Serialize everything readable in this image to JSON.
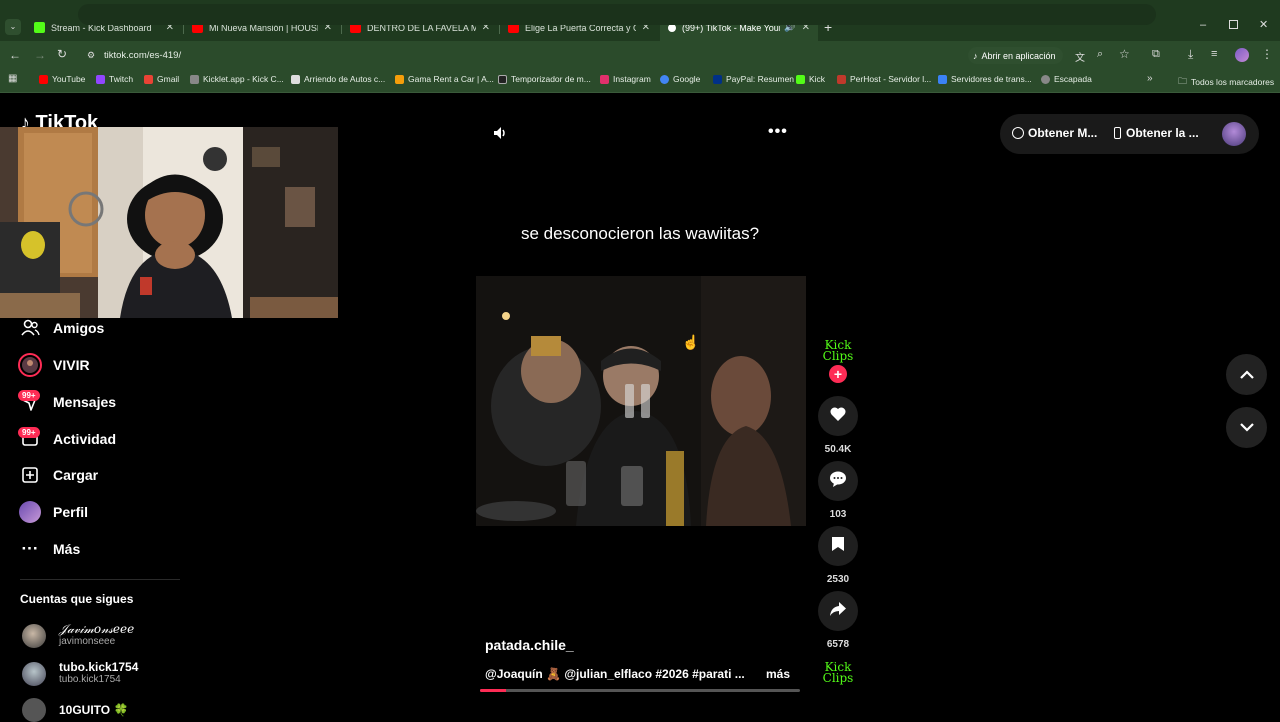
{
  "browser": {
    "tabs": [
      {
        "title": "Stream - Kick Dashboard",
        "favicon_color": "#53fc18"
      },
      {
        "title": "Mi Nueva Mansión | HOUSE TO",
        "favicon_color": "#ff0000"
      },
      {
        "title": "DENTRO DE LA FAVELA MÁS G",
        "favicon_color": "#ff0000"
      },
      {
        "title": "Elige La Puerta Correcta y Gana",
        "favicon_color": "#ff0000"
      },
      {
        "title": "(99+) TikTok - Make Your Da",
        "favicon_color": "#ffffff"
      }
    ],
    "url": "tiktok.com/es-419/",
    "open_in_app": "Abrir en aplicación",
    "bookmarks": [
      {
        "label": "YouTube",
        "color": "#ff0000"
      },
      {
        "label": "Twitch",
        "color": "#9146ff"
      },
      {
        "label": "Gmail",
        "color": "#ea4335"
      },
      {
        "label": "Kicklet.app - Kick C...",
        "color": "#888888"
      },
      {
        "label": "Arriendo de Autos c...",
        "color": "#dddddd"
      },
      {
        "label": "Gama Rent a Car | A...",
        "color": "#f59e0b"
      },
      {
        "label": "Temporizador de m...",
        "color": "#222222"
      },
      {
        "label": "Instagram",
        "color": "#e1306c"
      },
      {
        "label": "Google",
        "color": "#4285f4"
      },
      {
        "label": "PayPal: Resumen",
        "color": "#003087"
      },
      {
        "label": "Kick",
        "color": "#53fc18"
      },
      {
        "label": "PerHost - Servidor l...",
        "color": "#c0392b"
      },
      {
        "label": "Servidores de trans...",
        "color": "#3b82f6"
      },
      {
        "label": "Escapada",
        "color": "#888888"
      }
    ],
    "all_bookmarks": "Todos los marcadores"
  },
  "sidebar": {
    "items": [
      {
        "label": "Amigos",
        "icon": "friends-icon"
      },
      {
        "label": "VIVIR",
        "icon": "live-icon"
      },
      {
        "label": "Mensajes",
        "icon": "messages-icon",
        "badge": "99+"
      },
      {
        "label": "Actividad",
        "icon": "activity-icon",
        "badge": "99+"
      },
      {
        "label": "Cargar",
        "icon": "upload-icon"
      },
      {
        "label": "Perfil",
        "icon": "profile-icon"
      },
      {
        "label": "Más",
        "icon": "more-icon"
      }
    ],
    "following_title": "Cuentas que sigues",
    "following": [
      {
        "name": "𝒥𝒶𝓋𝒾𝓂𝑜𝓃𝓈𝑒𝑒𝑒",
        "handle": "javimonseee"
      },
      {
        "name": "tubo.kick1754",
        "handle": "tubo.kick1754"
      },
      {
        "name": "10GUITO 🍀",
        "handle": ""
      }
    ]
  },
  "header": {
    "get_app_1": "Obtener M...",
    "get_app_2": "Obtener la ..."
  },
  "video": {
    "caption": "se desconocieron las wawiitas?",
    "author": "patada.chile_",
    "description": "@Joaquín 🧸 @julian_elflaco #2026 #parati ...",
    "more": "más",
    "progress": 0.08
  },
  "actions": {
    "brand_top": "Kick Clips",
    "likes": "50.4K",
    "comments": "103",
    "saves": "2530",
    "shares": "6578",
    "brand_bottom": "Kick Clips"
  },
  "colors": {
    "accent": "#fe2c55",
    "kick_green": "#53fc18",
    "browser_frame": "#2b4b2b"
  }
}
